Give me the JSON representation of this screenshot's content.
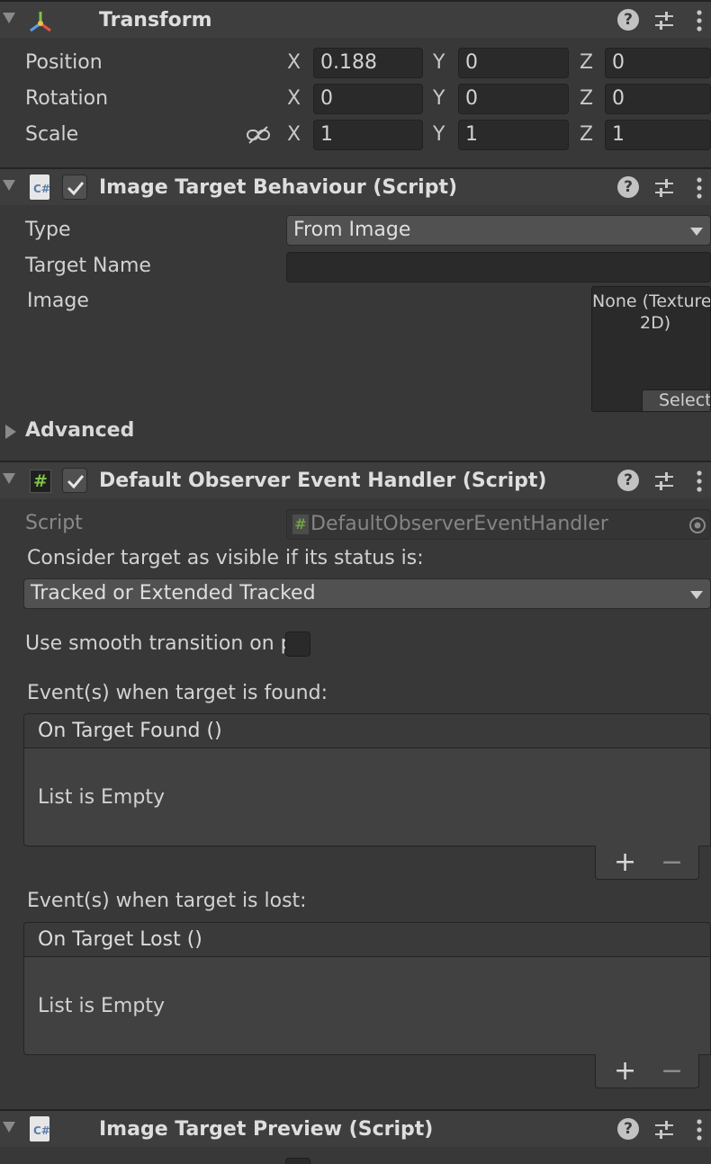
{
  "transform": {
    "title": "Transform",
    "position_label": "Position",
    "rotation_label": "Rotation",
    "scale_label": "Scale",
    "axis_x": "X",
    "axis_y": "Y",
    "axis_z": "Z",
    "position": {
      "x": "0.188",
      "y": "0",
      "z": "0"
    },
    "rotation": {
      "x": "0",
      "y": "0",
      "z": "0"
    },
    "scale": {
      "x": "1",
      "y": "1",
      "z": "1"
    }
  },
  "image_target": {
    "title": "Image Target Behaviour (Script)",
    "enabled": true,
    "type_label": "Type",
    "type_value": "From Image",
    "target_name_label": "Target Name",
    "target_name_value": "",
    "image_label": "Image",
    "image_value_line1": "None (Texture",
    "image_value_line2": "2D)",
    "select_label": "Select",
    "advanced_label": "Advanced"
  },
  "observer": {
    "title": "Default Observer Event Handler (Script)",
    "enabled": true,
    "script_label": "Script",
    "script_value": "DefaultObserverEventHandler",
    "consider_label": "Consider target as visible if its status is:",
    "status_value": "Tracked or Extended Tracked",
    "smooth_label": "Use smooth transition on p",
    "found_label": "Event(s) when target is found:",
    "found_event": "On Target Found ()",
    "lost_label": "Event(s) when target is lost:",
    "lost_event": "On Target Lost ()",
    "list_empty": "List is Empty",
    "plus": "+",
    "minus": "−"
  },
  "preview": {
    "title": "Image Target Preview (Script)"
  },
  "icons": {
    "help": "?",
    "cs": "C#",
    "hash": "#"
  },
  "colors": {
    "background": "#383838",
    "header": "#3e3e3e",
    "field": "#2a2a2a",
    "dropdown": "#515151",
    "accent_green": "#7ec24a"
  }
}
